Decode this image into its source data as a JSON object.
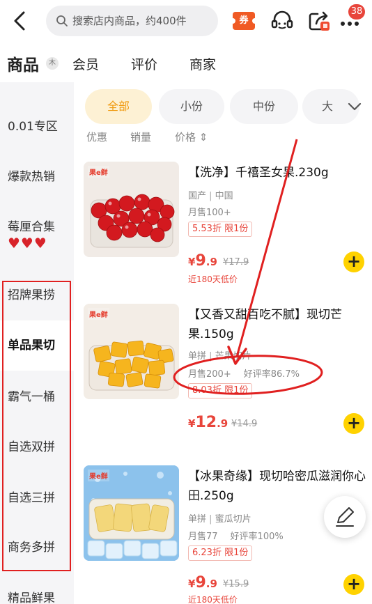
{
  "search": {
    "placeholder": "搜索店内商品，约400件"
  },
  "header": {
    "coupon_label": "券",
    "more_badge": "38"
  },
  "tabs": [
    {
      "label": "商品",
      "active": true
    },
    {
      "label": "会员"
    },
    {
      "label": "评价"
    },
    {
      "label": "商家"
    }
  ],
  "tab_zoom_label": "木",
  "sidebar": {
    "items": [
      {
        "label": "0.01专区"
      },
      {
        "label": "爆款热销"
      },
      {
        "label": "莓厘合集",
        "hearts": "♥♥♥"
      },
      {
        "label": "招牌果捞"
      },
      {
        "label": "单品果切",
        "active": true
      },
      {
        "label": "霸气一桶"
      },
      {
        "label": "自选双拼"
      },
      {
        "label": "自选三拼"
      },
      {
        "label": "商务多拼"
      },
      {
        "label": "精品鲜果"
      }
    ]
  },
  "filters": {
    "chips": [
      {
        "label": "全部",
        "active": true
      },
      {
        "label": "小份"
      },
      {
        "label": "中份"
      },
      {
        "label": "大"
      }
    ],
    "sort": [
      "优惠",
      "销量",
      "价格 ⇕"
    ]
  },
  "products": [
    {
      "name": "【洗净】千禧圣女果.230g",
      "logo": "果e鲜",
      "origin_label": "国产",
      "origin": "中国",
      "sales": "月售100+",
      "discount": "5.53折 限1份",
      "price_symbol": "¥",
      "price_int": "9",
      "price_dec": ".9",
      "orig_price": "¥17.9",
      "lowest": "近180天低价",
      "add": "+"
    },
    {
      "name": "【又香又甜百吃不腻】现切芒果.150g",
      "logo": "果e鲜",
      "spec_label": "单拼",
      "spec": "芒果切片",
      "sales": "月售200+",
      "rating": "好评率86.7%",
      "discount": "8.03折 限1份",
      "price_symbol": "¥",
      "price_int": "12",
      "price_dec": ".9",
      "orig_price": "¥14.9",
      "add": "+"
    },
    {
      "name": "【冰果奇缘】现切哈密瓜滋润你心田.250g",
      "logo": "果e鲜",
      "spec_label": "单拼",
      "spec": "蜜瓜切片",
      "sales": "月售77",
      "rating": "好评率100%",
      "discount": "6.23折 限1份",
      "price_symbol": "¥",
      "price_int": "9",
      "price_dec": ".9",
      "orig_price": "¥15.9",
      "lowest": "近180天低价",
      "add": "+"
    }
  ],
  "colors": {
    "accent_yellow": "#ffd200",
    "price_red": "#e8453b",
    "annotation_red": "#e02020"
  },
  "icons": [
    "back-arrow-icon",
    "search-icon",
    "coupon-icon",
    "customer-service-icon",
    "share-icon",
    "more-icon",
    "chevron-down-icon",
    "add-icon",
    "edit-icon"
  ]
}
